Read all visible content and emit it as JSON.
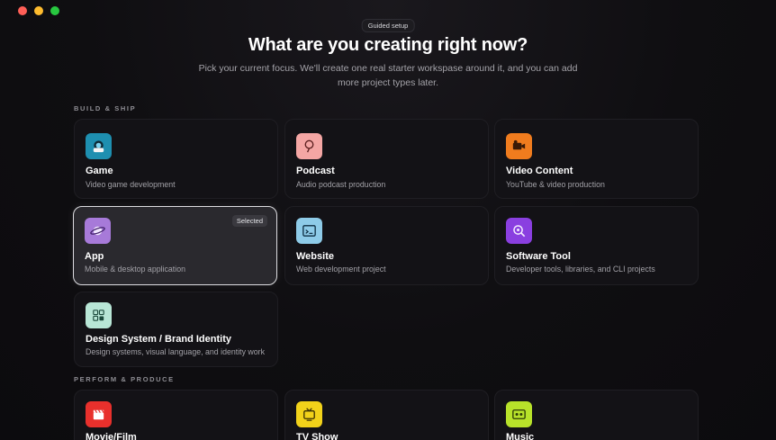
{
  "window": {
    "controls": [
      "close",
      "minimize",
      "zoom"
    ]
  },
  "header": {
    "badge": "Guided setup",
    "title": "What are you creating right now?",
    "subtitle": "Pick your current focus. We'll create one real starter workspase around it, and you can add more project types later."
  },
  "sections": [
    {
      "label": "BUILD & SHIP"
    },
    {
      "label": "PERFORM & PRODUCE"
    }
  ],
  "cards": [
    {
      "name": "Game",
      "desc": "Video game development",
      "icon": "game-controller-icon",
      "color": "#1e8fb0"
    },
    {
      "name": "Podcast",
      "desc": "Audio podcast production",
      "icon": "microphone-icon",
      "color": "#f4a6a4"
    },
    {
      "name": "Video Content",
      "desc": "YouTube & video production",
      "icon": "video-camera-icon",
      "color": "#f07c1e"
    },
    {
      "name": "App",
      "desc": "Mobile & desktop application",
      "icon": "planet-icon",
      "color": "#a77ad9",
      "badge": "Selected"
    },
    {
      "name": "Website",
      "desc": "Web development project",
      "icon": "terminal-window-icon",
      "color": "#8ecbe8"
    },
    {
      "name": "Software Tool",
      "desc": "Developer tools, libraries, and CLI projects",
      "icon": "magnifier-code-icon",
      "color": "#8a3fe0"
    },
    {
      "name": "Design System / Brand Identity",
      "desc": "Design systems, visual language, and identity work",
      "icon": "swatch-grid-icon",
      "color": "#b8e6d6"
    },
    {
      "name": "Movie/Film",
      "desc": "",
      "icon": "clapperboard-icon",
      "color": "#e8302c"
    },
    {
      "name": "TV Show",
      "desc": "",
      "icon": "tv-icon",
      "color": "#f2d21a"
    },
    {
      "name": "Music",
      "desc": "",
      "icon": "cassette-icon",
      "color": "#b8e22a"
    }
  ],
  "state": {
    "selected": "App"
  }
}
